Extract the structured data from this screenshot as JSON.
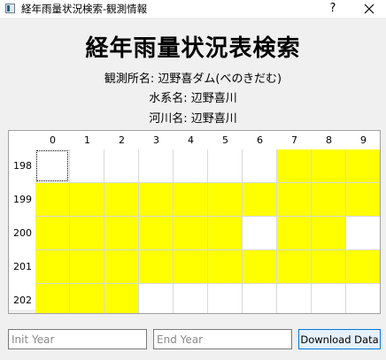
{
  "window": {
    "title": "経年雨量状況検索-観測情報",
    "help_label": "?"
  },
  "header": {
    "title": "経年雨量状況表検索",
    "station": "観測所名: 辺野喜ダム(べのきだむ)",
    "water_system": "水系名: 辺野喜川",
    "river": "河川名: 辺野喜川"
  },
  "grid": {
    "columns": [
      "0",
      "1",
      "2",
      "3",
      "4",
      "5",
      "6",
      "7",
      "8",
      "9"
    ],
    "rows": [
      {
        "label": "198",
        "cells": [
          0,
          0,
          0,
          0,
          0,
          0,
          0,
          1,
          1,
          1
        ]
      },
      {
        "label": "199",
        "cells": [
          1,
          1,
          1,
          1,
          1,
          1,
          1,
          1,
          1,
          1
        ]
      },
      {
        "label": "200",
        "cells": [
          1,
          1,
          1,
          1,
          1,
          1,
          0,
          1,
          1,
          0
        ]
      },
      {
        "label": "201",
        "cells": [
          1,
          1,
          1,
          1,
          1,
          1,
          1,
          1,
          1,
          1
        ]
      },
      {
        "label": "202",
        "cells": [
          1,
          1,
          1,
          0,
          0,
          0,
          0,
          0,
          0,
          0
        ]
      }
    ],
    "current_cell": {
      "row": 0,
      "col": 0
    },
    "fill_color": "#ffff00",
    "empty_color": "#ffffff"
  },
  "controls": {
    "init_year_placeholder": "Init Year",
    "init_year_value": "",
    "end_year_placeholder": "End Year",
    "end_year_value": "",
    "download_label": "Download Data"
  },
  "icons": {
    "app": "app-icon",
    "help": "help-icon",
    "close": "close-icon"
  }
}
